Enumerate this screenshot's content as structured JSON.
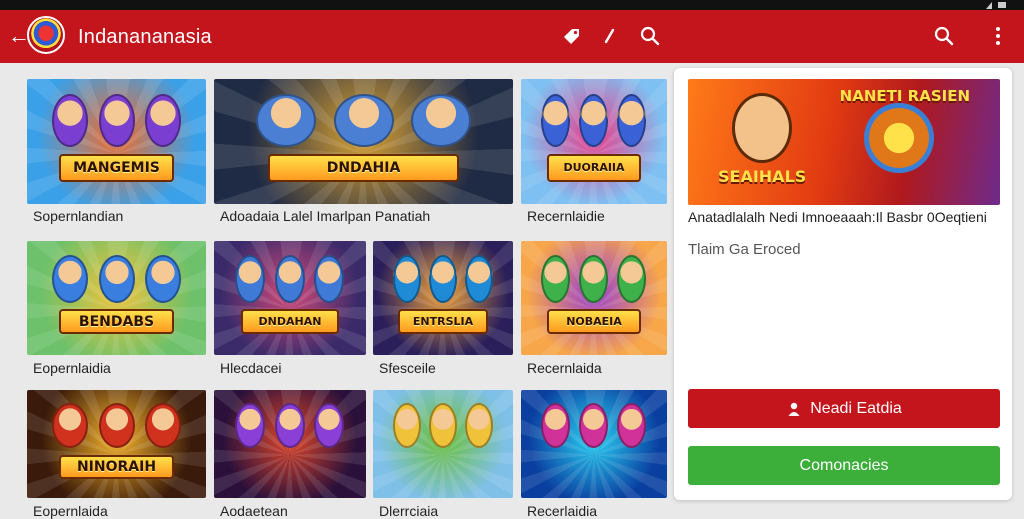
{
  "app": {
    "title": "Indanananasia",
    "colors": {
      "primary": "#c4141c",
      "accent_green": "#3cae3a",
      "background": "#e9e9ea"
    }
  },
  "toolbar": {
    "icons": [
      "back-arrow-icon",
      "app-logo",
      "tag-icon",
      "pen-icon",
      "search-icon",
      "search-icon",
      "more-vert-icon"
    ]
  },
  "grid": {
    "items": [
      {
        "caption": "Sopernlandian",
        "banner": "MANGEMIS",
        "palette": [
          "#3aa0e8",
          "#f26b2a",
          "#7a3fd0"
        ]
      },
      {
        "caption": "Adoadaia Lalel Imarlpan Panatiah",
        "banner": "DNDAHIA",
        "palette": [
          "#1f2a44",
          "#d9a133",
          "#4a7fd4"
        ]
      },
      {
        "caption": "Recernlaidie",
        "banner": "DUORAIIA",
        "palette": [
          "#7ec0f2",
          "#e93e8c",
          "#3a62d6"
        ]
      },
      {
        "caption": "Eopernlaidia",
        "banner": "BENDABS",
        "palette": [
          "#6cc16a",
          "#f0c23a",
          "#3a7fe0"
        ]
      },
      {
        "caption": "Hlecdacei",
        "banner": "DNDAHAN",
        "palette": [
          "#3a2a6a",
          "#d24a7a",
          "#3f7ad6"
        ]
      },
      {
        "caption": "Sfesceile",
        "banner": "ENTRSLIA",
        "palette": [
          "#2a1f5a",
          "#f0a23a",
          "#1f8ad6"
        ]
      },
      {
        "caption": "Recernlaida",
        "banner": "NOBAEIA",
        "palette": [
          "#f7a64a",
          "#9a3fd0",
          "#3fb14a"
        ]
      },
      {
        "caption": "Eopernlaida",
        "banner": "NINORAIH",
        "palette": [
          "#3a1a0a",
          "#f5b12a",
          "#d0321d"
        ]
      },
      {
        "caption": "Aodaetean",
        "banner": "",
        "palette": [
          "#2a103a",
          "#e0462a",
          "#8a3fd6"
        ]
      },
      {
        "caption": "Dlerrciaia",
        "banner": "",
        "palette": [
          "#7fc0e8",
          "#6abf3a",
          "#f0c23a"
        ]
      },
      {
        "caption": "Recerlaidia",
        "banner": "",
        "palette": [
          "#0a3fa0",
          "#2ad0f2",
          "#d0329a"
        ]
      }
    ]
  },
  "detail": {
    "feature_title": "NANETI RASIEN",
    "feature_banner": "SEAIHALS",
    "headline": "Anatadlalalh Nedi Imnoeaaah:Il Basbr 0Oeqtieni",
    "subtext": "Tlaim Ga Eroced",
    "primary_button": {
      "label": "Neadi Eatdia",
      "icon": "person-icon"
    },
    "secondary_button": {
      "label": "Comonacies"
    }
  }
}
